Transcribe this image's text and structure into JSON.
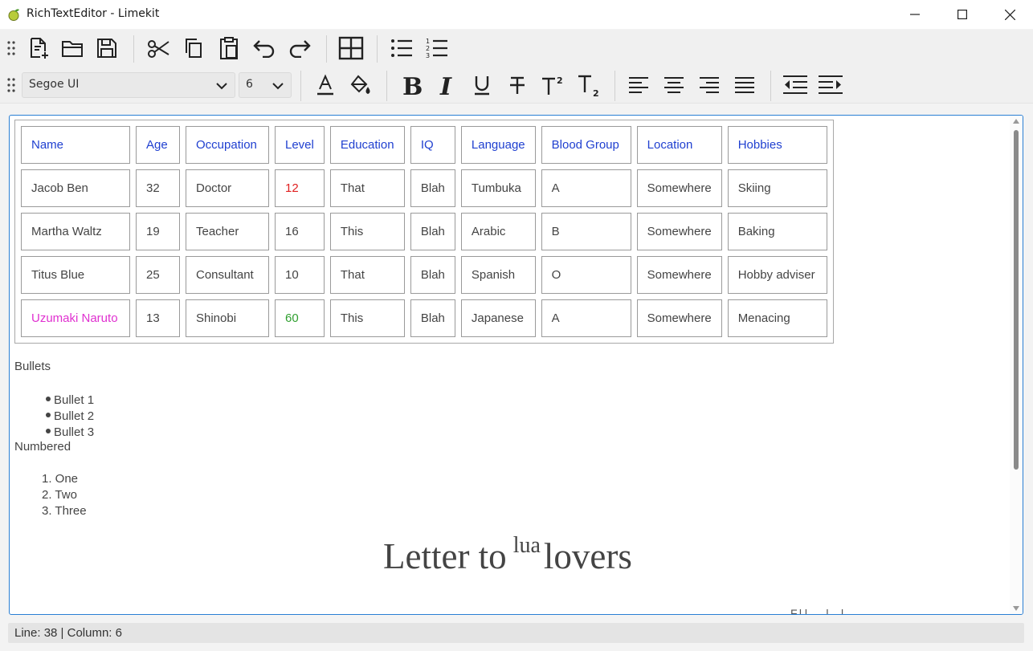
{
  "window": {
    "title": "RichTextEditor - Limekit"
  },
  "toolbar1": {
    "buttons": [
      "new-file",
      "open-folder",
      "save",
      "cut",
      "copy",
      "paste",
      "undo",
      "redo",
      "insert-table",
      "bullet-list",
      "numbered-list"
    ]
  },
  "toolbar2": {
    "font_family": "Segoe UI",
    "font_size": "6",
    "buttons": [
      "font-color",
      "fill-color",
      "bold",
      "italic",
      "underline",
      "strikethrough",
      "superscript",
      "subscript",
      "align-left",
      "align-center",
      "align-right",
      "justify",
      "decrease-indent",
      "increase-indent"
    ]
  },
  "table": {
    "headers": [
      "Name",
      "Age",
      "Occupation",
      "Level",
      "Education",
      "IQ",
      "Language",
      "Blood Group",
      "Location",
      "Hobbies"
    ],
    "rows": [
      [
        "Jacob Ben",
        "32",
        "Doctor",
        "12",
        "That",
        "Blah",
        "Tumbuka",
        "A",
        "Somewhere",
        "Skiing"
      ],
      [
        "Martha Waltz",
        "19",
        "Teacher",
        "16",
        "This",
        "Blah",
        "Arabic",
        "B",
        "Somewhere",
        "Baking"
      ],
      [
        "Titus Blue",
        "25",
        "Consultant",
        "10",
        "That",
        "Blah",
        "Spanish",
        "O",
        "Somewhere",
        "Hobby adviser"
      ],
      [
        "Uzumaki Naruto",
        "13",
        "Shinobi",
        "60",
        "This",
        "Blah",
        "Japanese",
        "A",
        "Somewhere",
        "Menacing"
      ]
    ],
    "colors": {
      "header": "#2040d0",
      "jacob_level": "#e02020",
      "naruto_name": "#e030d0",
      "naruto_level": "#30a030"
    }
  },
  "content": {
    "bullets_label": "Bullets",
    "bullets": [
      "Bullet 1",
      "Bullet 2",
      "Bullet 3"
    ],
    "numbered_label": "Numbered",
    "numbered": [
      "1. One",
      "2. Two",
      "3. Three"
    ],
    "heading_before": "Letter to",
    "heading_sup": "lua",
    "heading_after": "lovers",
    "cutoff_line": "F.l.l.    .. .l              .  .l"
  },
  "status": {
    "text": "Line: 38 | Column: 6"
  },
  "colors": {
    "accent": "#2a7fd4"
  }
}
